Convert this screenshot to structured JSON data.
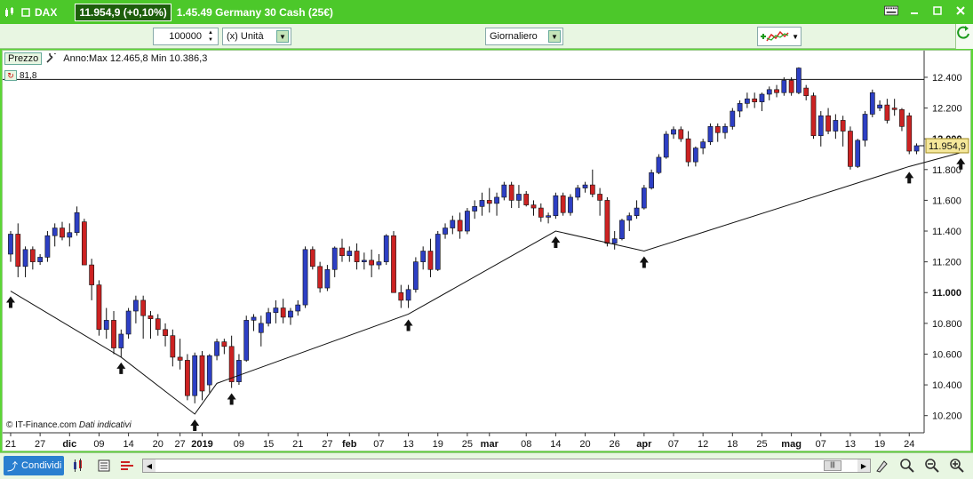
{
  "titlebar": {
    "symbol": "DAX",
    "price": "11.954,9 (+0,10%)",
    "description": "1.45.49 Germany 30 Cash (25€)"
  },
  "toolbar": {
    "quantity": "100000",
    "unit": "(x) Unità",
    "period": "Giornaliero"
  },
  "legend": {
    "badge": "Prezzo",
    "range": "Anno:Max 12.465,8 Min 10.386,3",
    "indicator_value": "81,8"
  },
  "footnote": {
    "source": "© IT-Finance.com",
    "note": "Dati indicativi"
  },
  "bottombar": {
    "share_label": "Condividi"
  },
  "colors": {
    "up": "#2d3fc4",
    "down": "#cc2222",
    "frame": "#4fd12a",
    "last_price_bg": "#f5e79a"
  },
  "chart_data": {
    "type": "candlestick",
    "ylim": [
      10100,
      12550
    ],
    "y_ticks": [
      "10.200",
      "10.400",
      "10.600",
      "10.800",
      "11.000",
      "11.200",
      "11.400",
      "11.600",
      "11.800",
      "12.000",
      "12.200",
      "12.400"
    ],
    "y_tick_values": [
      10200,
      10400,
      10600,
      10800,
      11000,
      11200,
      11400,
      11600,
      11800,
      12000,
      12200,
      12400
    ],
    "x_labels": [
      {
        "label": "21",
        "idx": 0,
        "bold": false
      },
      {
        "label": "27",
        "idx": 4,
        "bold": false
      },
      {
        "label": "dic",
        "idx": 8,
        "bold": true
      },
      {
        "label": "09",
        "idx": 12,
        "bold": false
      },
      {
        "label": "14",
        "idx": 16,
        "bold": false
      },
      {
        "label": "20",
        "idx": 20,
        "bold": false
      },
      {
        "label": "27",
        "idx": 23,
        "bold": false
      },
      {
        "label": "2019",
        "idx": 26,
        "bold": true
      },
      {
        "label": "09",
        "idx": 31,
        "bold": false
      },
      {
        "label": "15",
        "idx": 35,
        "bold": false
      },
      {
        "label": "21",
        "idx": 39,
        "bold": false
      },
      {
        "label": "27",
        "idx": 43,
        "bold": false
      },
      {
        "label": "feb",
        "idx": 46,
        "bold": true
      },
      {
        "label": "07",
        "idx": 50,
        "bold": false
      },
      {
        "label": "13",
        "idx": 54,
        "bold": false
      },
      {
        "label": "19",
        "idx": 58,
        "bold": false
      },
      {
        "label": "25",
        "idx": 62,
        "bold": false
      },
      {
        "label": "mar",
        "idx": 65,
        "bold": true
      },
      {
        "label": "08",
        "idx": 70,
        "bold": false
      },
      {
        "label": "14",
        "idx": 74,
        "bold": false
      },
      {
        "label": "20",
        "idx": 78,
        "bold": false
      },
      {
        "label": "26",
        "idx": 82,
        "bold": false
      },
      {
        "label": "apr",
        "idx": 86,
        "bold": true
      },
      {
        "label": "07",
        "idx": 90,
        "bold": false
      },
      {
        "label": "12",
        "idx": 94,
        "bold": false
      },
      {
        "label": "18",
        "idx": 98,
        "bold": false
      },
      {
        "label": "25",
        "idx": 102,
        "bold": false
      },
      {
        "label": "mag",
        "idx": 106,
        "bold": true
      },
      {
        "label": "07",
        "idx": 110,
        "bold": false
      },
      {
        "label": "13",
        "idx": 114,
        "bold": false
      },
      {
        "label": "19",
        "idx": 118,
        "bold": false
      },
      {
        "label": "24",
        "idx": 122,
        "bold": false
      }
    ],
    "last_price": 11954.9,
    "last_price_label": "11.954,9",
    "max_line": 12386,
    "candles": [
      [
        11250,
        11400,
        11200,
        11380
      ],
      [
        11380,
        11450,
        11100,
        11170
      ],
      [
        11170,
        11300,
        11100,
        11280
      ],
      [
        11280,
        11300,
        11150,
        11200
      ],
      [
        11200,
        11250,
        11180,
        11230
      ],
      [
        11230,
        11400,
        11200,
        11370
      ],
      [
        11370,
        11450,
        11300,
        11420
      ],
      [
        11420,
        11460,
        11340,
        11360
      ],
      [
        11360,
        11450,
        11300,
        11390
      ],
      [
        11390,
        11560,
        11370,
        11520
      ],
      [
        11460,
        11480,
        11200,
        11180
      ],
      [
        11180,
        11220,
        10950,
        11050
      ],
      [
        11050,
        11080,
        10720,
        10760
      ],
      [
        10760,
        10900,
        10700,
        10820
      ],
      [
        10820,
        10880,
        10600,
        10640
      ],
      [
        10640,
        10760,
        10580,
        10730
      ],
      [
        10730,
        10900,
        10700,
        10880
      ],
      [
        10880,
        10980,
        10800,
        10950
      ],
      [
        10950,
        10980,
        10700,
        10850
      ],
      [
        10850,
        10880,
        10700,
        10830
      ],
      [
        10830,
        10860,
        10720,
        10760
      ],
      [
        10760,
        10800,
        10650,
        10720
      ],
      [
        10720,
        10760,
        10520,
        10580
      ],
      [
        10580,
        10700,
        10500,
        10560
      ],
      [
        10560,
        10600,
        10300,
        10330
      ],
      [
        10330,
        10610,
        10280,
        10590
      ],
      [
        10590,
        10620,
        10300,
        10360
      ],
      [
        10400,
        10600,
        10350,
        10590
      ],
      [
        10590,
        10700,
        10560,
        10680
      ],
      [
        10680,
        10700,
        10600,
        10650
      ],
      [
        10650,
        10720,
        10380,
        10420
      ],
      [
        10420,
        10600,
        10400,
        10560
      ],
      [
        10560,
        10850,
        10550,
        10820
      ],
      [
        10820,
        10860,
        10750,
        10840
      ],
      [
        10740,
        10850,
        10650,
        10800
      ],
      [
        10800,
        10900,
        10780,
        10870
      ],
      [
        10870,
        10950,
        10800,
        10900
      ],
      [
        10900,
        10960,
        10800,
        10840
      ],
      [
        10840,
        10900,
        10790,
        10880
      ],
      [
        10880,
        10950,
        10850,
        10920
      ],
      [
        10920,
        11300,
        10900,
        11280
      ],
      [
        11280,
        11300,
        11150,
        11170
      ],
      [
        11170,
        11200,
        11000,
        11030
      ],
      [
        11030,
        11180,
        11010,
        11150
      ],
      [
        11150,
        11300,
        11100,
        11290
      ],
      [
        11290,
        11350,
        11200,
        11240
      ],
      [
        11240,
        11300,
        11200,
        11270
      ],
      [
        11270,
        11320,
        11150,
        11200
      ],
      [
        11200,
        11260,
        11150,
        11210
      ],
      [
        11210,
        11280,
        11100,
        11180
      ],
      [
        11180,
        11250,
        11150,
        11200
      ],
      [
        11200,
        11380,
        11180,
        11370
      ],
      [
        11370,
        11400,
        11000,
        11000
      ],
      [
        11000,
        11050,
        10900,
        10950
      ],
      [
        10950,
        11050,
        10900,
        11020
      ],
      [
        11020,
        11230,
        11000,
        11200
      ],
      [
        11200,
        11300,
        11150,
        11270
      ],
      [
        11270,
        11350,
        11100,
        11150
      ],
      [
        11150,
        11400,
        11140,
        11380
      ],
      [
        11380,
        11450,
        11350,
        11420
      ],
      [
        11420,
        11500,
        11380,
        11470
      ],
      [
        11470,
        11520,
        11350,
        11400
      ],
      [
        11400,
        11550,
        11380,
        11530
      ],
      [
        11530,
        11600,
        11480,
        11560
      ],
      [
        11560,
        11650,
        11500,
        11600
      ],
      [
        11600,
        11680,
        11520,
        11580
      ],
      [
        11580,
        11650,
        11500,
        11620
      ],
      [
        11620,
        11720,
        11600,
        11700
      ],
      [
        11700,
        11720,
        11550,
        11600
      ],
      [
        11600,
        11700,
        11550,
        11640
      ],
      [
        11640,
        11660,
        11560,
        11570
      ],
      [
        11570,
        11600,
        11500,
        11550
      ],
      [
        11550,
        11580,
        11460,
        11490
      ],
      [
        11490,
        11520,
        11450,
        11500
      ],
      [
        11500,
        11650,
        11480,
        11630
      ],
      [
        11630,
        11650,
        11500,
        11520
      ],
      [
        11520,
        11640,
        11500,
        11620
      ],
      [
        11620,
        11700,
        11600,
        11680
      ],
      [
        11680,
        11720,
        11650,
        11700
      ],
      [
        11700,
        11800,
        11620,
        11640
      ],
      [
        11640,
        11680,
        11500,
        11600
      ],
      [
        11600,
        11620,
        11300,
        11320
      ],
      [
        11320,
        11400,
        11280,
        11350
      ],
      [
        11350,
        11480,
        11340,
        11470
      ],
      [
        11470,
        11520,
        11400,
        11500
      ],
      [
        11500,
        11600,
        11480,
        11550
      ],
      [
        11550,
        11700,
        11540,
        11680
      ],
      [
        11680,
        11800,
        11670,
        11780
      ],
      [
        11780,
        11900,
        11770,
        11880
      ],
      [
        11880,
        12050,
        11870,
        12030
      ],
      [
        12030,
        12080,
        12000,
        12060
      ],
      [
        12060,
        12080,
        11980,
        12000
      ],
      [
        12000,
        12050,
        11820,
        11850
      ],
      [
        11850,
        11950,
        11820,
        11940
      ],
      [
        11940,
        12000,
        11900,
        11980
      ],
      [
        11980,
        12100,
        11960,
        12080
      ],
      [
        12080,
        12100,
        11980,
        12040
      ],
      [
        12040,
        12100,
        12000,
        12080
      ],
      [
        12080,
        12200,
        12060,
        12180
      ],
      [
        12180,
        12250,
        12140,
        12230
      ],
      [
        12230,
        12300,
        12200,
        12260
      ],
      [
        12260,
        12300,
        12200,
        12240
      ],
      [
        12240,
        12300,
        12180,
        12290
      ],
      [
        12290,
        12340,
        12250,
        12320
      ],
      [
        12320,
        12350,
        12270,
        12300
      ],
      [
        12300,
        12400,
        12280,
        12380
      ],
      [
        12380,
        12400,
        12280,
        12300
      ],
      [
        12300,
        12465,
        12290,
        12460
      ],
      [
        12330,
        12350,
        12250,
        12280
      ],
      [
        12280,
        12300,
        12000,
        12020
      ],
      [
        12020,
        12180,
        11950,
        12150
      ],
      [
        12150,
        12200,
        12030,
        12050
      ],
      [
        12050,
        12160,
        12000,
        12120
      ],
      [
        12120,
        12150,
        11950,
        12050
      ],
      [
        12050,
        12080,
        11800,
        11820
      ],
      [
        11820,
        12000,
        11810,
        11990
      ],
      [
        11990,
        12180,
        11950,
        12160
      ],
      [
        12160,
        12320,
        12140,
        12300
      ],
      [
        12200,
        12250,
        12180,
        12220
      ],
      [
        12220,
        12260,
        12100,
        12120
      ],
      [
        12200,
        12260,
        12150,
        12190
      ],
      [
        12190,
        12200,
        12050,
        12080
      ],
      [
        12150,
        12170,
        11900,
        11920
      ],
      [
        11920,
        11970,
        11900,
        11955
      ]
    ],
    "trendline": [
      {
        "idx": 0,
        "value": 11010
      },
      {
        "idx": 15,
        "value": 10580
      },
      {
        "idx": 25,
        "value": 10210
      },
      {
        "idx": 28,
        "value": 10410
      },
      {
        "idx": 54,
        "value": 10860
      },
      {
        "idx": 74,
        "value": 11400
      },
      {
        "idx": 86,
        "value": 11270
      },
      {
        "idx": 122,
        "value": 11820
      },
      {
        "idx": 129,
        "value": 11910
      }
    ],
    "arrows": [
      0,
      15,
      25,
      30,
      54,
      74,
      86,
      122,
      129
    ]
  }
}
